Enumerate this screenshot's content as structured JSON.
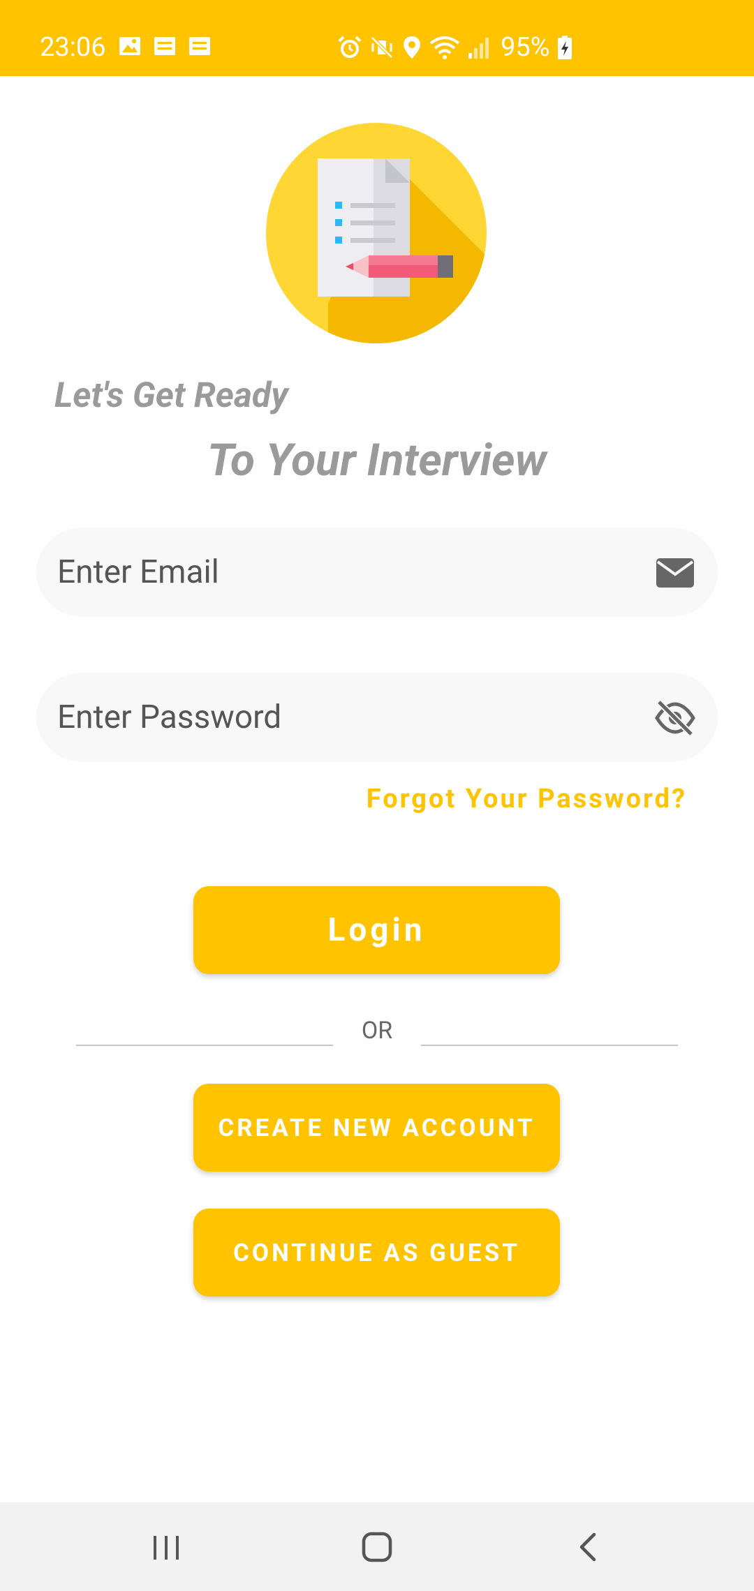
{
  "status_bar": {
    "time": "23:06",
    "battery": "95%",
    "left_icons": [
      "image-icon",
      "message-icon",
      "message-icon"
    ],
    "right_icons": [
      "alarm-icon",
      "mute-icon",
      "location-icon",
      "wifi-icon",
      "signal-icon",
      "battery-charging-icon"
    ]
  },
  "logo": {
    "icon": "document-pencil-icon",
    "colors": {
      "circle": "#FFD633",
      "shadow": "#F5B800",
      "paper": "#E8E8EE",
      "bullet": "#2DB7F5",
      "pencil": "#F25A78"
    }
  },
  "headline": {
    "line1": "Let's Get Ready",
    "line2": "To Your Interview"
  },
  "form": {
    "email": {
      "placeholder": "Enter Email",
      "value": "",
      "icon": "envelope-icon"
    },
    "password": {
      "placeholder": "Enter Password",
      "value": "",
      "icon": "eye-off-icon"
    },
    "forgot_label": "Forgot Your Password?"
  },
  "actions": {
    "login_label": "Login",
    "divider_label": "OR",
    "create_label": "CREATE NEW ACCOUNT",
    "guest_label": "CONTINUE AS GUEST"
  },
  "nav": {
    "icons": [
      "recents-icon",
      "home-icon",
      "back-icon"
    ]
  },
  "colors": {
    "accent": "#FFC300",
    "heading_gray": "#9A9A9A",
    "field_bg": "#F8F8F8"
  }
}
